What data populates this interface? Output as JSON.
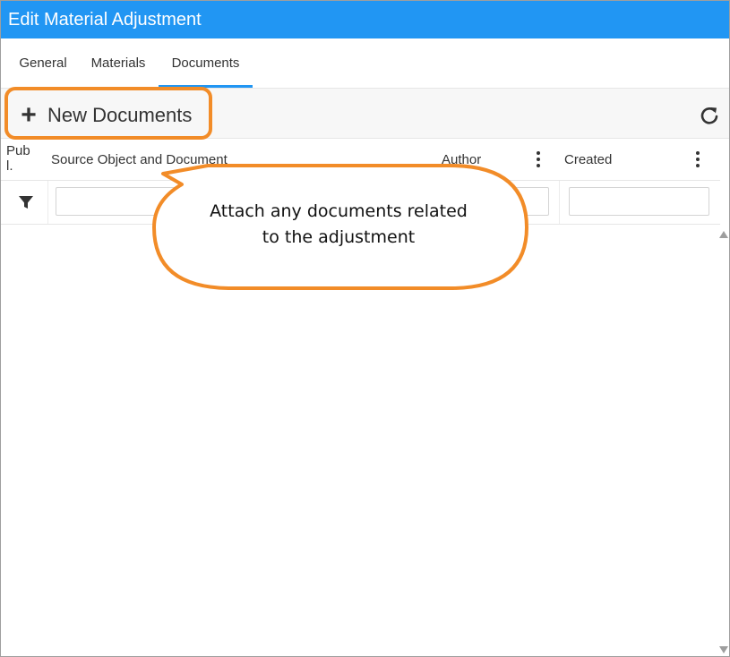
{
  "window": {
    "title": "Edit Material Adjustment"
  },
  "tabs": [
    {
      "label": "General",
      "active": false
    },
    {
      "label": "Materials",
      "active": false
    },
    {
      "label": "Documents",
      "active": true
    }
  ],
  "toolbar": {
    "new_documents_label": "New Documents",
    "new_documents_icon": "plus-icon",
    "refresh_icon": "refresh-icon"
  },
  "grid": {
    "columns": [
      {
        "label": "Pub\nl."
      },
      {
        "label": "Source Object and Document"
      },
      {
        "label": "Author"
      },
      {
        "label": "Created"
      }
    ],
    "filter_icon": "filter-icon",
    "rows": []
  },
  "callout": {
    "text_line1": "Attach any documents related",
    "text_line2": "to the adjustment"
  },
  "colors": {
    "titlebar": "#2196f3",
    "active_tab_underline": "#2196f3",
    "callout_border": "#f28c28"
  }
}
